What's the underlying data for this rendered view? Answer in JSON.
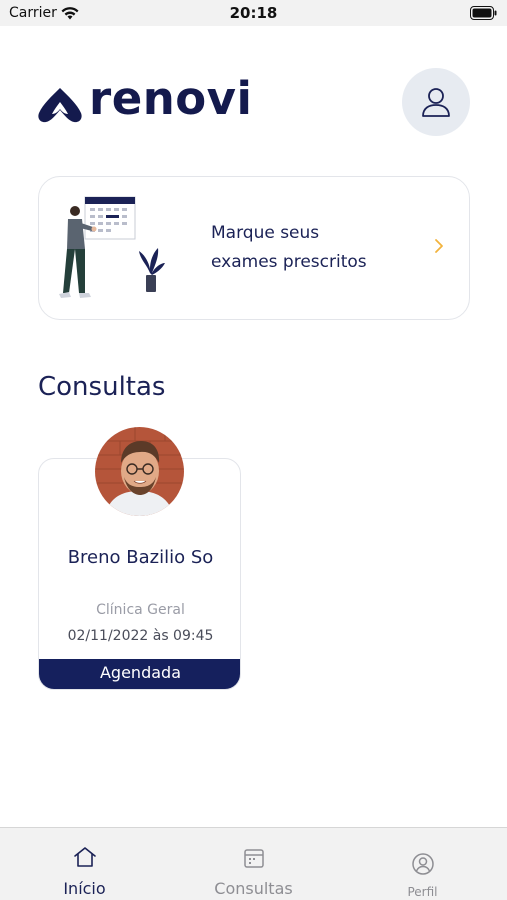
{
  "status_bar": {
    "carrier": "Carrier",
    "time": "20:18"
  },
  "header": {
    "logo_text": "renovi",
    "profile_icon": "user-icon"
  },
  "promo": {
    "line1": "Marque seus",
    "line2": "exames prescritos",
    "chevron_icon": "chevron-right-icon"
  },
  "consultas": {
    "title": "Consultas",
    "items": [
      {
        "doctor_name": "Breno Bazilio So",
        "specialty": "Clínica Geral",
        "datetime": "02/11/2022 às 09:45",
        "status": "Agendada"
      }
    ]
  },
  "tab_bar": {
    "items": [
      {
        "label": "Início",
        "icon": "home-icon",
        "active": true
      },
      {
        "label": "Consultas",
        "icon": "calendar-icon",
        "active": false
      },
      {
        "label": "Perfil",
        "icon": "user-circle-icon",
        "active": false
      }
    ]
  },
  "colors": {
    "primary": "#15205d",
    "accent": "#f2b33d",
    "text": "#1b2256",
    "muted": "#9a9ca6",
    "tab_active": "#1b2256",
    "tab_inactive": "#8e8e93"
  }
}
